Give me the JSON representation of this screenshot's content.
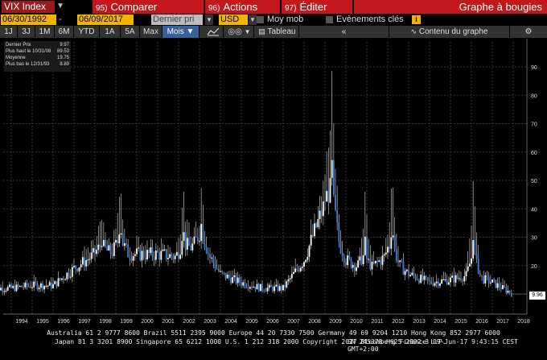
{
  "header": {
    "ticker": "VIX Index",
    "buttons": [
      {
        "num": "95)",
        "label": "Comparer"
      },
      {
        "num": "96)",
        "label": "Actions"
      },
      {
        "num": "97)",
        "label": "Éditer"
      }
    ],
    "title": "Graphe à bougies"
  },
  "controls": {
    "start_date": "06/30/1992",
    "end_date": "06/09/2017",
    "field": "Dernier pri",
    "currency": "USD",
    "moy_mob": "Moy mob",
    "events": "Evènements clés",
    "info": "i"
  },
  "toolbar": {
    "ranges": [
      "1J",
      "3J",
      "1M",
      "6M",
      "YTD",
      "1A",
      "5A",
      "Max"
    ],
    "period": "Mois",
    "table": "Tableau",
    "collapse": "«",
    "content": "Contenu du graphe"
  },
  "legend": {
    "rows": [
      {
        "label": "Dernier Prix",
        "value": "9.97"
      },
      {
        "label": "Plus haut le 10/31/08",
        "value": "89.53"
      },
      {
        "label": "Moyenne",
        "value": "19.75"
      },
      {
        "label": "Plus bas le 12/31/93",
        "value": "8.89"
      }
    ]
  },
  "last_value": "9.96",
  "footer": {
    "line1": "Australia 61 2 9777 8600 Brazil 5511 2395 9000 Europe 44 20 7330 7500 Germany 49 69 9204 1210 Hong Kong 852 2977 6000",
    "line2_left": "Japan 81 3 3201 8900      Singapore 65 6212 1000      U.S. 1 212 318 2000      Copyright 2017 Bloomberg Finance L.P.",
    "line2_right": "SN 245378 H625-2892-3 09-Jun-17  9:43:15 CEST GMT+2:00"
  },
  "colors": {
    "accent": "#c3171b",
    "input": "#f0b300",
    "up": "#3d7fd9",
    "down": "#ffffff"
  },
  "chart_data": {
    "type": "candlestick",
    "x_ticks": [
      "1994",
      "1995",
      "1996",
      "1997",
      "1998",
      "1999",
      "2000",
      "2001",
      "2002",
      "2003",
      "2004",
      "2005",
      "2006",
      "2007",
      "2008",
      "2009",
      "2010",
      "2011",
      "2012",
      "2013",
      "2014",
      "2015",
      "2016",
      "2017",
      "2018"
    ],
    "y_ticks": [
      20,
      30,
      40,
      50,
      60,
      70,
      80,
      90
    ],
    "ylim": [
      8,
      95
    ],
    "yearly_close": [
      [
        "1993",
        12
      ],
      [
        "1994",
        13
      ],
      [
        "1995",
        13
      ],
      [
        "1996",
        19
      ],
      [
        "1997",
        24
      ],
      [
        "1998",
        25
      ],
      [
        "1999",
        24
      ],
      [
        "2000",
        24
      ],
      [
        "2001",
        23
      ],
      [
        "2002",
        29
      ],
      [
        "2003",
        17
      ],
      [
        "2004",
        14
      ],
      [
        "2005",
        12
      ],
      [
        "2006",
        12
      ],
      [
        "2007",
        22
      ],
      [
        "2008",
        42
      ],
      [
        "2009",
        22
      ],
      [
        "2010",
        18
      ],
      [
        "2011",
        24
      ],
      [
        "2012",
        17
      ],
      [
        "2013",
        14
      ],
      [
        "2014",
        15
      ],
      [
        "2015",
        17
      ],
      [
        "2016",
        14
      ],
      [
        "2017",
        10
      ]
    ],
    "peaks": [
      [
        "1997.8",
        38
      ],
      [
        "1998.7",
        48
      ],
      [
        "2001.7",
        43
      ],
      [
        "2002.6",
        45
      ],
      [
        "2008.8",
        89.53
      ],
      [
        "2010.4",
        45
      ],
      [
        "2011.7",
        48
      ],
      [
        "2015.6",
        53
      ]
    ],
    "high": 89.53,
    "low": 8.89,
    "mean": 19.75,
    "last": 9.97
  }
}
